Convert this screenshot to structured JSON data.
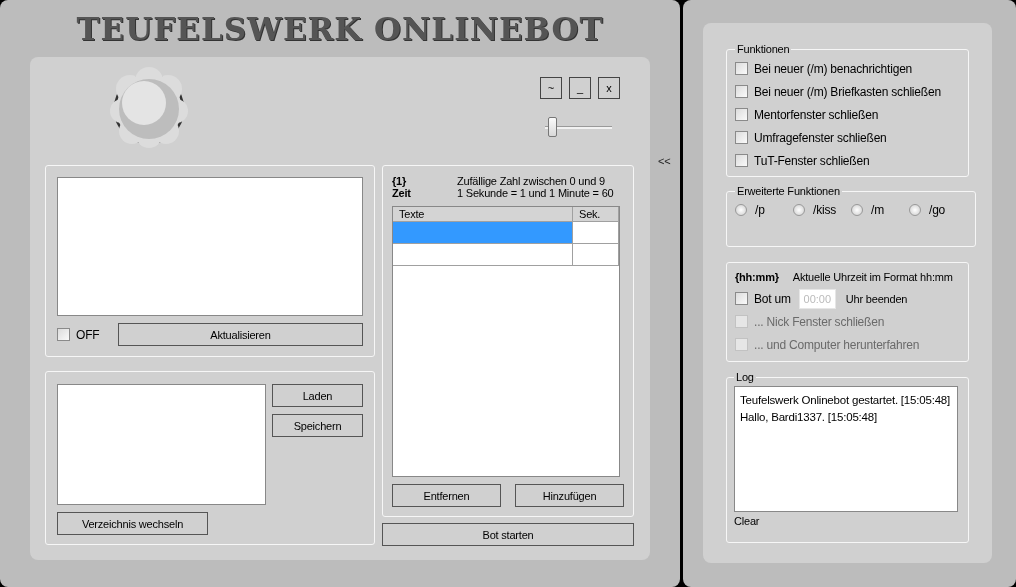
{
  "window": {
    "title": "TEUFELSWERK ONLINEBOT",
    "window_buttons": [
      "~",
      "_",
      "x"
    ],
    "zoom_slider": {
      "level": 0.05
    },
    "collapse_button": "<<"
  },
  "message_panel": {
    "off_checkbox": {
      "label": "OFF",
      "checked": false
    },
    "refresh_button": "Aktualisieren"
  },
  "file_panel": {
    "buttons": [
      "Laden",
      "Speichern"
    ],
    "change_dir_button": "Verzeichnis wechseln"
  },
  "texts_panel": {
    "legend": [
      {
        "token": "{1}",
        "description": "Zufällige Zahl zwischen 0 und 9"
      },
      {
        "token": "Zeit",
        "description": "1 Sekunde = 1 und 1 Minute = 60"
      }
    ],
    "table": {
      "columns": [
        "Texte",
        "Sek."
      ],
      "rows": [
        {
          "selected": true
        },
        {
          "selected": false
        }
      ]
    },
    "buttons": [
      "Entfernen",
      "Hinzufügen"
    ]
  },
  "start_button": "Bot starten",
  "functions": {
    "title": "Funktionen",
    "options": [
      {
        "label": "Bei neuer (/m) benachrichtigen",
        "checked": false
      },
      {
        "label": "Bei neuer (/m) Briefkasten schließen",
        "checked": false
      },
      {
        "label": "Mentorfenster schließen",
        "checked": false
      },
      {
        "label": "Umfragefenster schließen",
        "checked": false
      },
      {
        "label": "TuT-Fenster schließen",
        "checked": false
      }
    ]
  },
  "extended_functions": {
    "title": "Erweiterte Funktionen",
    "options": [
      {
        "label": "/p",
        "selected": false
      },
      {
        "label": "/kiss",
        "selected": false
      },
      {
        "label": "/m",
        "selected": false
      },
      {
        "label": "/go",
        "selected": false
      }
    ]
  },
  "schedule": {
    "token": "{hh:mm}",
    "description": "Aktuelle Uhrzeit im Format hh:mm",
    "stop_bot": {
      "label_before": "Bot um",
      "placeholder": "00:00",
      "label_after": "Uhr beenden",
      "checked": false
    },
    "sub_options": [
      {
        "label": "... Nick Fenster schließen",
        "checked": false,
        "disabled": true
      },
      {
        "label": "... und Computer herunterfahren",
        "checked": false,
        "disabled": true
      }
    ]
  },
  "log": {
    "title": "Log",
    "lines": [
      "Teufelswerk Onlinebot gestartet. [15:05:48]",
      "Hallo, Bardi1337. [15:05:48]"
    ],
    "clear": "Clear"
  }
}
